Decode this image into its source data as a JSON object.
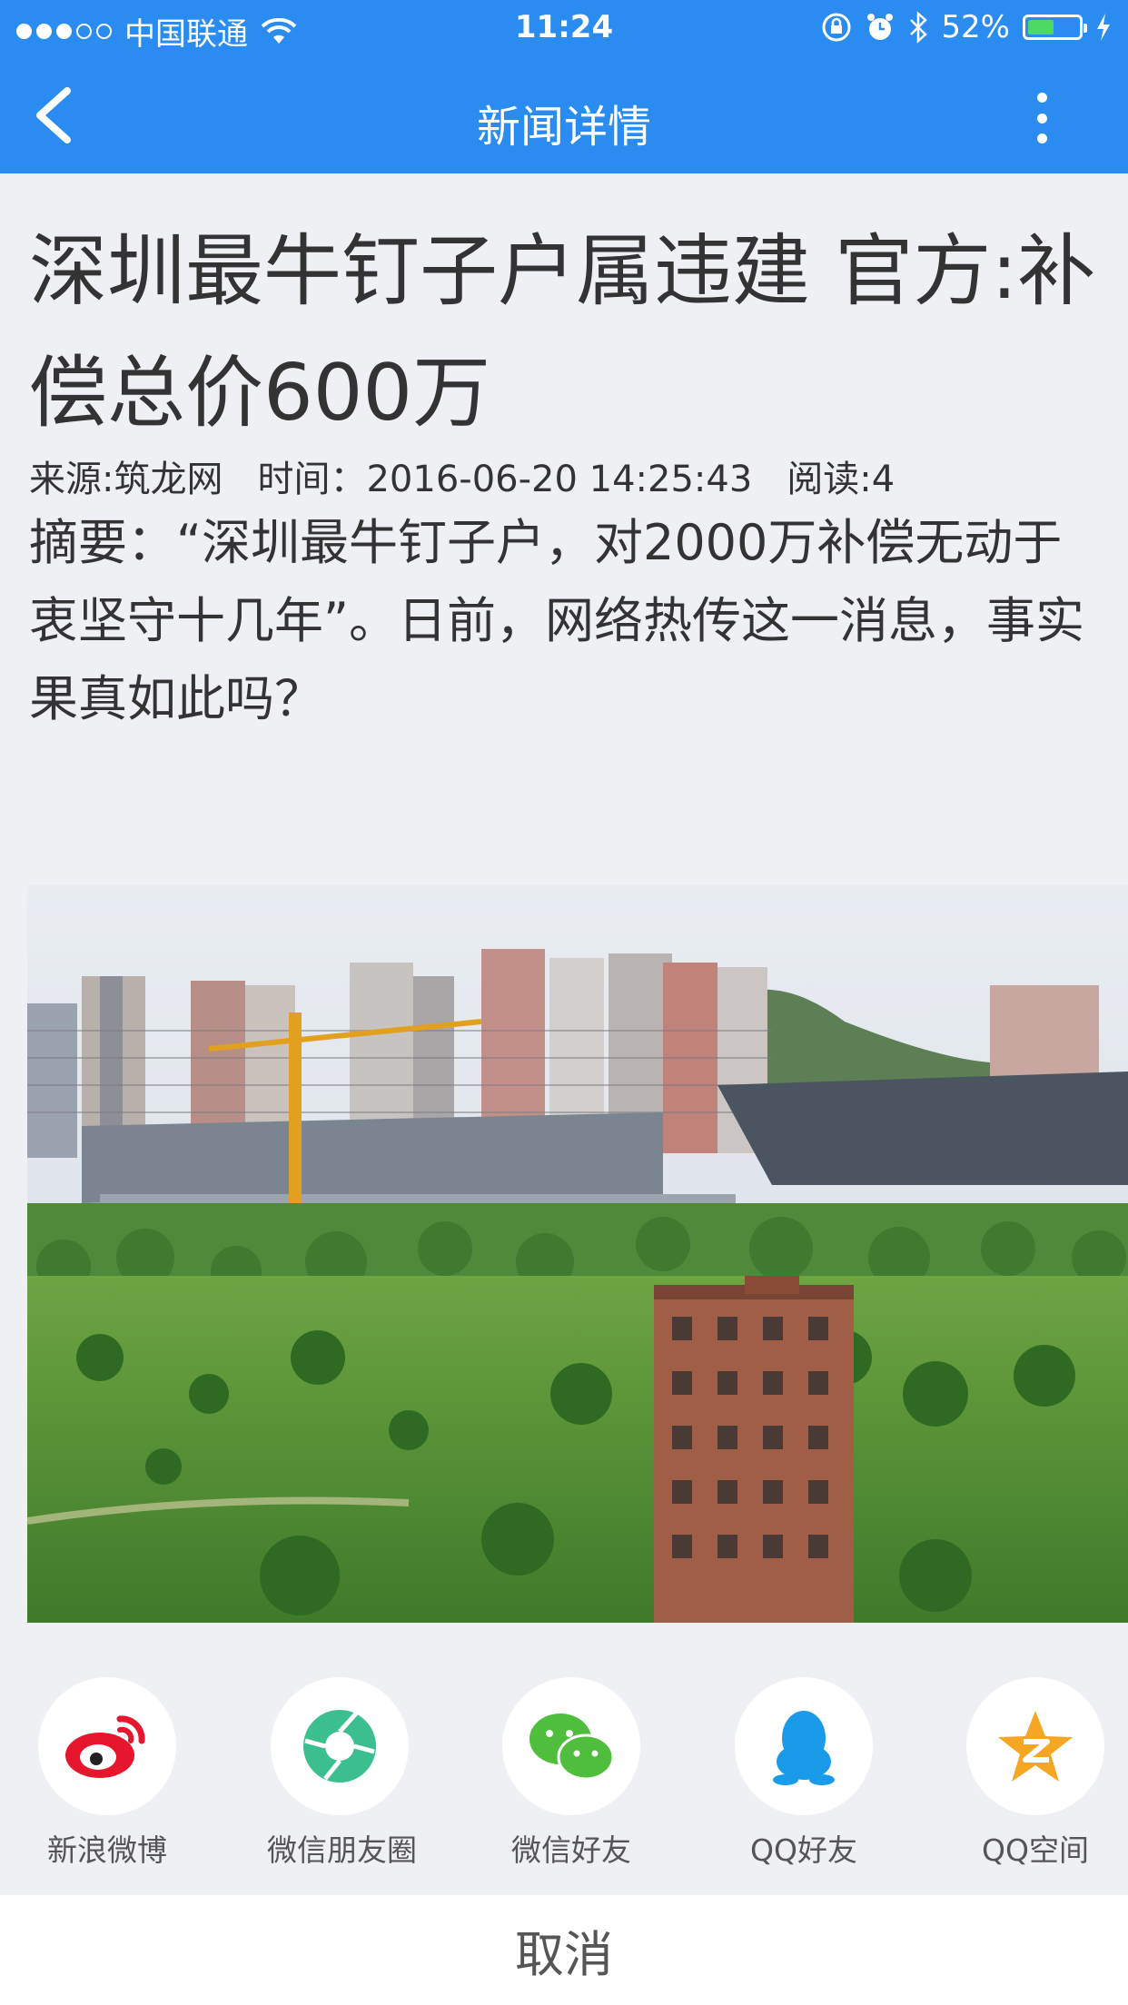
{
  "status_bar": {
    "carrier": "中国联通",
    "time": "11:24",
    "battery_text": "52%",
    "battery_level": 0.52
  },
  "nav": {
    "title": "新闻详情"
  },
  "article": {
    "title": "深圳最牛钉子户属违建 官方:补偿总价600万",
    "source": "来源:筑龙网",
    "time": "时间：2016-06-20 14:25:43",
    "reads": "阅读:4",
    "summary": "摘要：“深圳最牛钉子户，对2000万补偿无动于衷坚守十几年”。日前，网络热传这一消息，事实果真如此吗？"
  },
  "share": {
    "items": [
      {
        "label": "新浪微博",
        "icon": "weibo-icon",
        "color": "#e6162d"
      },
      {
        "label": "微信朋友圈",
        "icon": "moments-icon",
        "color": "#3cbf8e"
      },
      {
        "label": "微信好友",
        "icon": "wechat-icon",
        "color": "#4fbe3c"
      },
      {
        "label": "QQ好友",
        "icon": "qq-icon",
        "color": "#1a9bea"
      },
      {
        "label": "QQ空间",
        "icon": "qzone-icon",
        "color": "#f5a623"
      }
    ],
    "cancel_label": "取消"
  },
  "colors": {
    "header_blue": "#2a8cf0",
    "background": "#eff0f4"
  }
}
